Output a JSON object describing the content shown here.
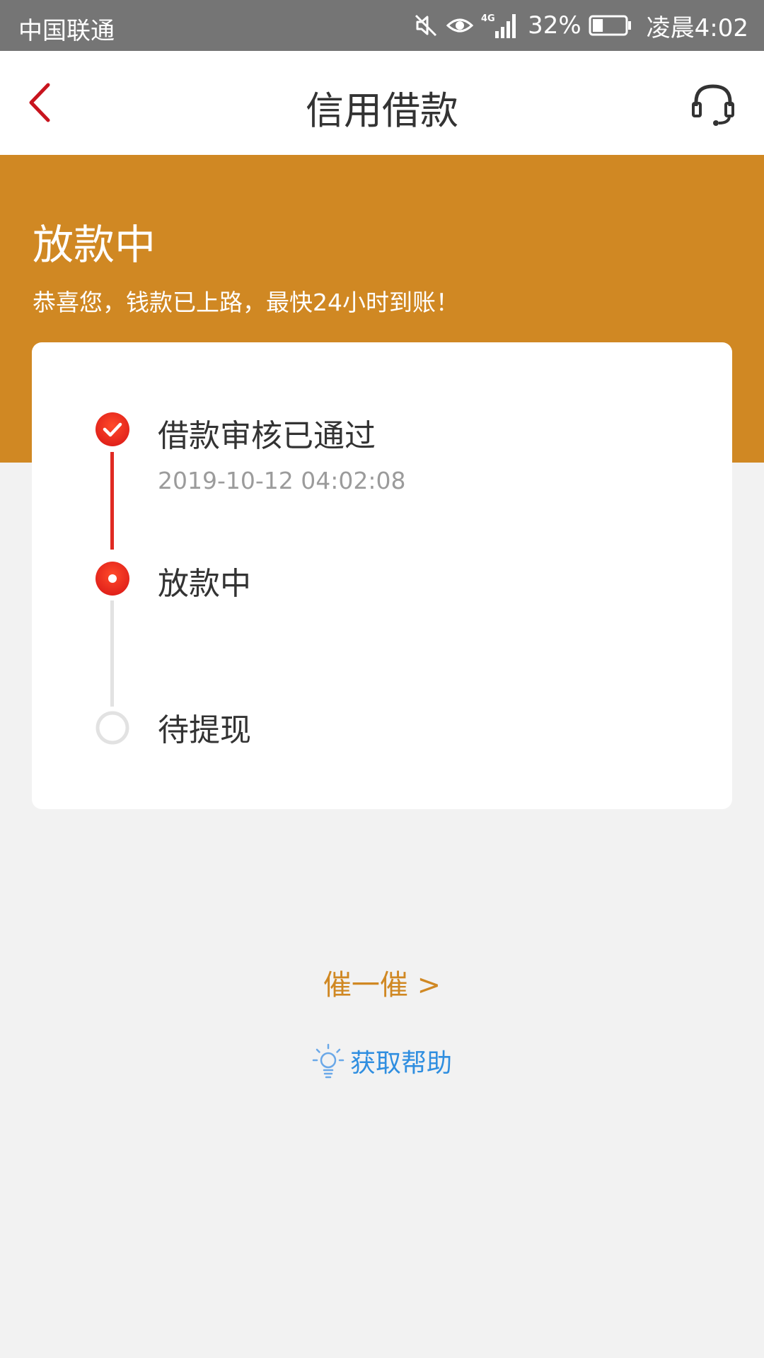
{
  "status_bar": {
    "carrier": "中国联通",
    "network": "4G",
    "battery": "32%",
    "battery_level": 0.32,
    "time": "凌晨4:02",
    "icons": [
      "mute-icon",
      "eye-icon",
      "signal-icon",
      "battery-icon"
    ]
  },
  "nav": {
    "title": "信用借款",
    "back_icon": "chevron-left-icon",
    "service_icon": "headset-icon"
  },
  "banner": {
    "title": "放款中",
    "subtitle": "恭喜您，钱款已上路，最快24小时到账！"
  },
  "steps": [
    {
      "label": "借款审核已通过",
      "time": "2019-10-12 04:02:08",
      "state": "done"
    },
    {
      "label": "放款中",
      "time": "",
      "state": "current"
    },
    {
      "label": "待提现",
      "time": "",
      "state": "pending"
    }
  ],
  "actions": {
    "urge": "催一催 >",
    "help": "获取帮助",
    "help_icon": "lightbulb-icon"
  },
  "colors": {
    "accent_orange": "#d08823",
    "progress_red": "#e02a23",
    "link_blue": "#2f8ee0",
    "status_bar_gray": "#757575"
  }
}
